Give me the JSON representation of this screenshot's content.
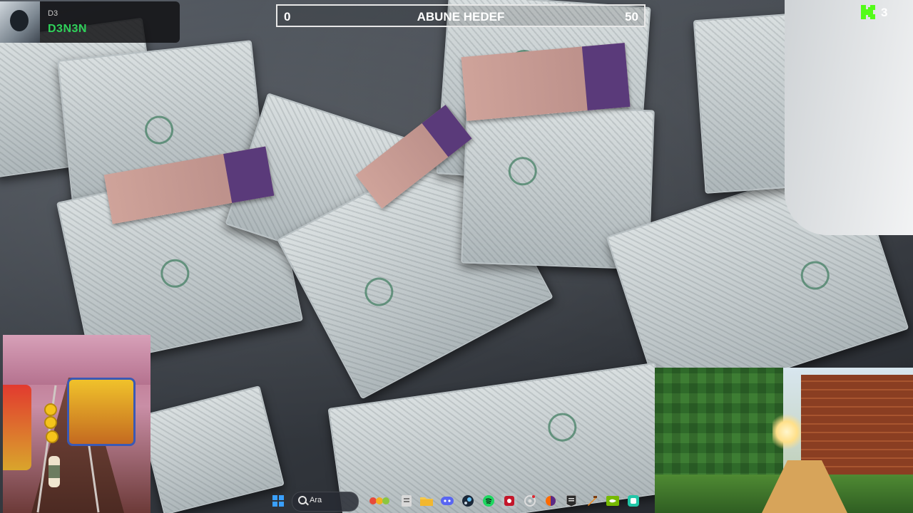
{
  "webcam": {
    "tag": "D3",
    "name": "D3N3N"
  },
  "goal": {
    "start": "0",
    "title": "ABUNE HEDEF",
    "end": "50",
    "progress": 0
  },
  "kick": {
    "count": "3",
    "accent": "#53fc18"
  },
  "taskbar": {
    "search_placeholder": "Ara",
    "icons": [
      "windows-start-icon",
      "search-icon",
      "fruits-widget-icon",
      "file-icon",
      "file-explorer-icon",
      "discord-icon",
      "steam-icon",
      "spotify-icon",
      "record-icon",
      "obs-icon",
      "browser-icon",
      "epic-games-icon",
      "game-icon",
      "nvidia-icon",
      "app-icon"
    ]
  },
  "colors": {
    "name_green": "#2fd15a",
    "goal_border": "#e8e8e8"
  }
}
